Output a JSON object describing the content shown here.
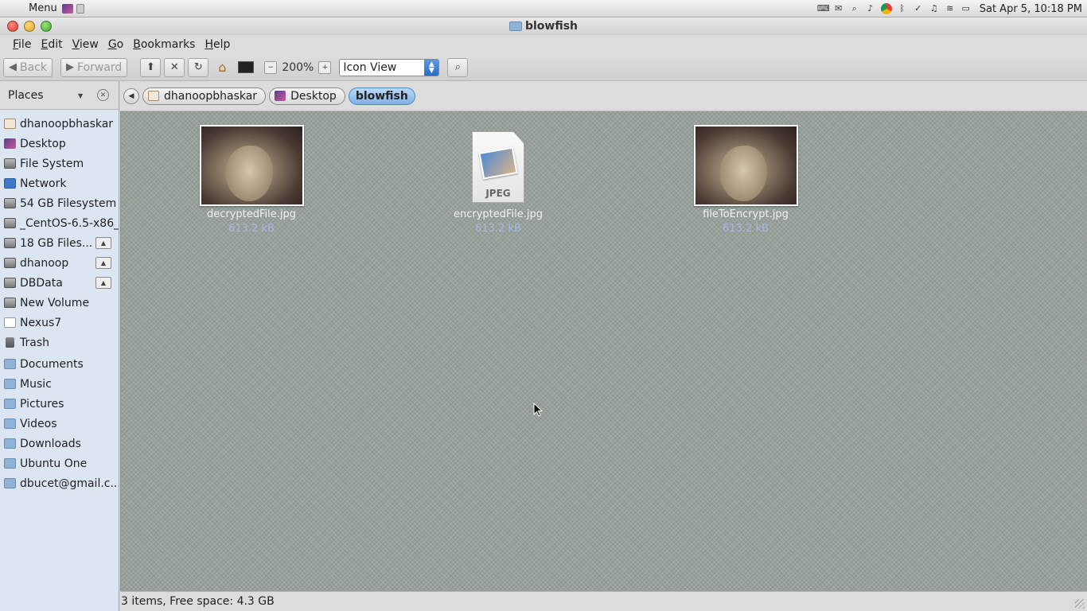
{
  "top_panel": {
    "menu_label": "Menu",
    "clock": "Sat Apr  5, 10:18 PM"
  },
  "window": {
    "title": "blowfish"
  },
  "menubar": {
    "items": [
      "File",
      "Edit",
      "View",
      "Go",
      "Bookmarks",
      "Help"
    ]
  },
  "toolbar": {
    "back_label": "Back",
    "forward_label": "Forward",
    "zoom_level": "200%",
    "view_mode": "Icon View"
  },
  "sidebar": {
    "header": "Places",
    "items": [
      {
        "label": "dhanoopbhaskar",
        "icon": "home-icon"
      },
      {
        "label": "Desktop",
        "icon": "desktop-icon"
      },
      {
        "label": "File System",
        "icon": "drive-icon"
      },
      {
        "label": "Network",
        "icon": "network-icon"
      },
      {
        "label": "54 GB Filesystem",
        "icon": "drive-icon"
      },
      {
        "label": "_CentOS-6.5-x86_",
        "icon": "drive-icon"
      },
      {
        "label": "18 GB Files...",
        "icon": "drive-icon"
      },
      {
        "label": "dhanoop",
        "icon": "drive-icon"
      },
      {
        "label": "DBData",
        "icon": "drive-icon"
      },
      {
        "label": "New Volume",
        "icon": "drive-icon"
      },
      {
        "label": "Nexus7",
        "icon": "device-icon"
      },
      {
        "label": "Trash",
        "icon": "trash-icon"
      },
      {
        "label": "Documents",
        "icon": "folder-icon"
      },
      {
        "label": "Music",
        "icon": "folder-icon"
      },
      {
        "label": "Pictures",
        "icon": "folder-icon"
      },
      {
        "label": "Videos",
        "icon": "folder-icon"
      },
      {
        "label": "Downloads",
        "icon": "folder-icon"
      },
      {
        "label": "Ubuntu One",
        "icon": "folder-icon"
      },
      {
        "label": "dbucet@gmail.c...",
        "icon": "folder-icon"
      }
    ]
  },
  "pathbar": {
    "crumbs": [
      "dhanoopbhaskar",
      "Desktop",
      "blowfish"
    ]
  },
  "files": [
    {
      "name": "decryptedFile.jpg",
      "size": "613.2 kB",
      "icon": "image-thumbnail"
    },
    {
      "name": "encryptedFile.jpg",
      "size": "613.2 kB",
      "icon": "jpeg-file-icon"
    },
    {
      "name": "fileToEncrypt.jpg",
      "size": "613.2 kB",
      "icon": "image-thumbnail"
    }
  ],
  "statusbar": {
    "text": "3 items, Free space: 4.3 GB"
  }
}
